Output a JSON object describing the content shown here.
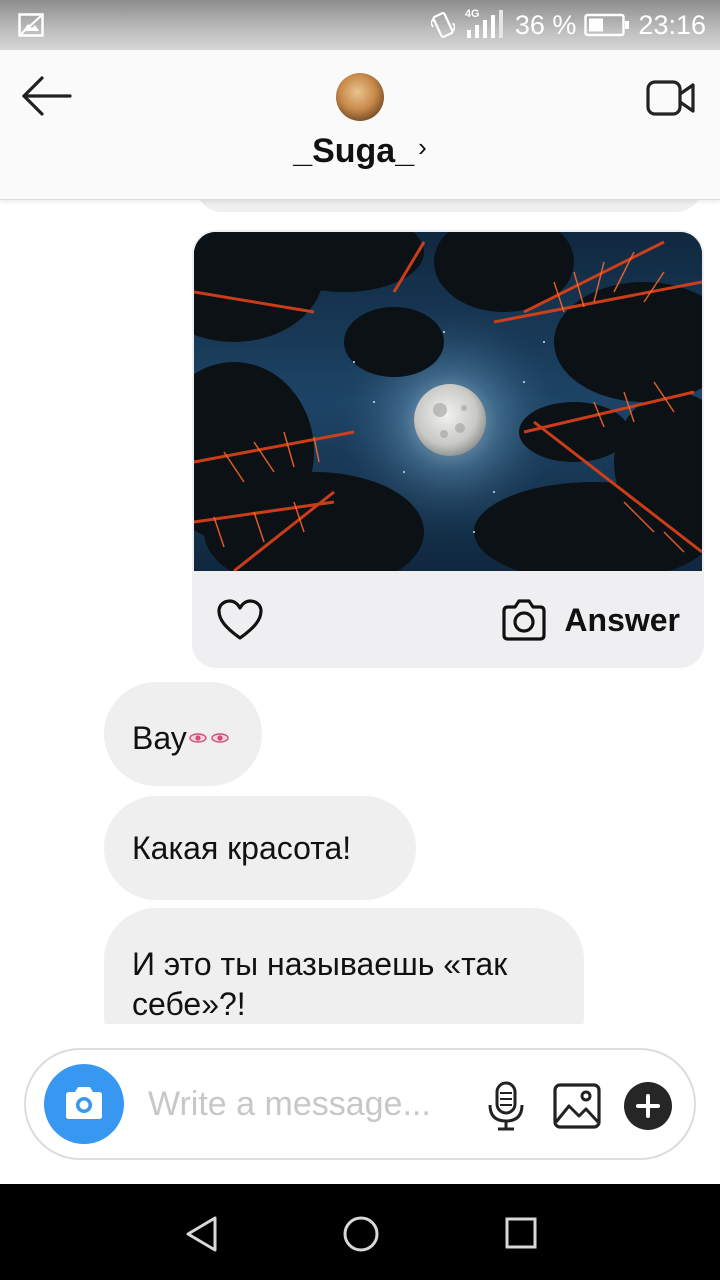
{
  "status_bar": {
    "network_label": "4G",
    "battery_percent": "36 %",
    "time": "23:16",
    "icons": [
      "gallery-icon",
      "vibrate-icon",
      "signal-icon",
      "battery-icon"
    ]
  },
  "header": {
    "contact_name": "_Suga_",
    "icons": [
      "back-arrow-icon",
      "video-call-icon",
      "chevron-right-icon"
    ]
  },
  "photo_message": {
    "answer_label": "Answer",
    "icons": [
      "heart-icon",
      "camera-outline-icon"
    ]
  },
  "messages": [
    {
      "text": "Вау",
      "has_eyes_emoji": true
    },
    {
      "text": "Какая красота!"
    },
    {
      "text": "И это ты называешь «так себе»?!"
    }
  ],
  "composer": {
    "placeholder": "Write a message...",
    "icons": [
      "camera-icon",
      "microphone-icon",
      "image-icon",
      "plus-icon"
    ]
  },
  "nav_bar": {
    "icons": [
      "nav-back-icon",
      "nav-home-icon",
      "nav-recents-icon"
    ]
  },
  "colors": {
    "accent_blue": "#3897f0",
    "bubble_bg": "#efefef",
    "header_bg": "#fafafa",
    "nav_bg": "#000000",
    "eyes_pink": "#d14d7a"
  }
}
